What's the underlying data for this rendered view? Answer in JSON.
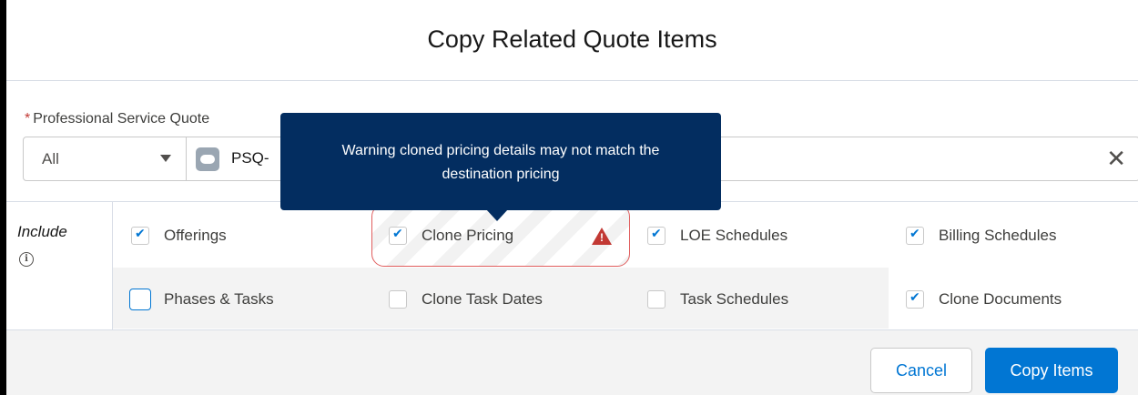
{
  "modal": {
    "title": "Copy Related Quote Items"
  },
  "quote_field": {
    "required_marker": "*",
    "label": "Professional Service Quote",
    "scope_value": "All",
    "selected_text": "PSQ-",
    "clear_icon": "close-icon"
  },
  "tooltip": {
    "line1": "Warning cloned pricing details may not match the",
    "line2": "destination pricing"
  },
  "include": {
    "label": "Include",
    "info_icon": "i",
    "options": [
      {
        "label": "Offerings",
        "checked": true
      },
      {
        "label": "Clone Pricing",
        "checked": true,
        "warning": true
      },
      {
        "label": "LOE Schedules",
        "checked": true
      },
      {
        "label": "Billing Schedules",
        "checked": true
      },
      {
        "label": "Phases & Tasks",
        "checked": false
      },
      {
        "label": "Clone Task Dates",
        "checked": false
      },
      {
        "label": "Task Schedules",
        "checked": false
      },
      {
        "label": "Clone Documents",
        "checked": true
      }
    ]
  },
  "footer": {
    "cancel_label": "Cancel",
    "copy_label": "Copy Items"
  },
  "colors": {
    "brand": "#0176d3",
    "tooltip_bg": "#032d60",
    "warning": "#c23934"
  }
}
